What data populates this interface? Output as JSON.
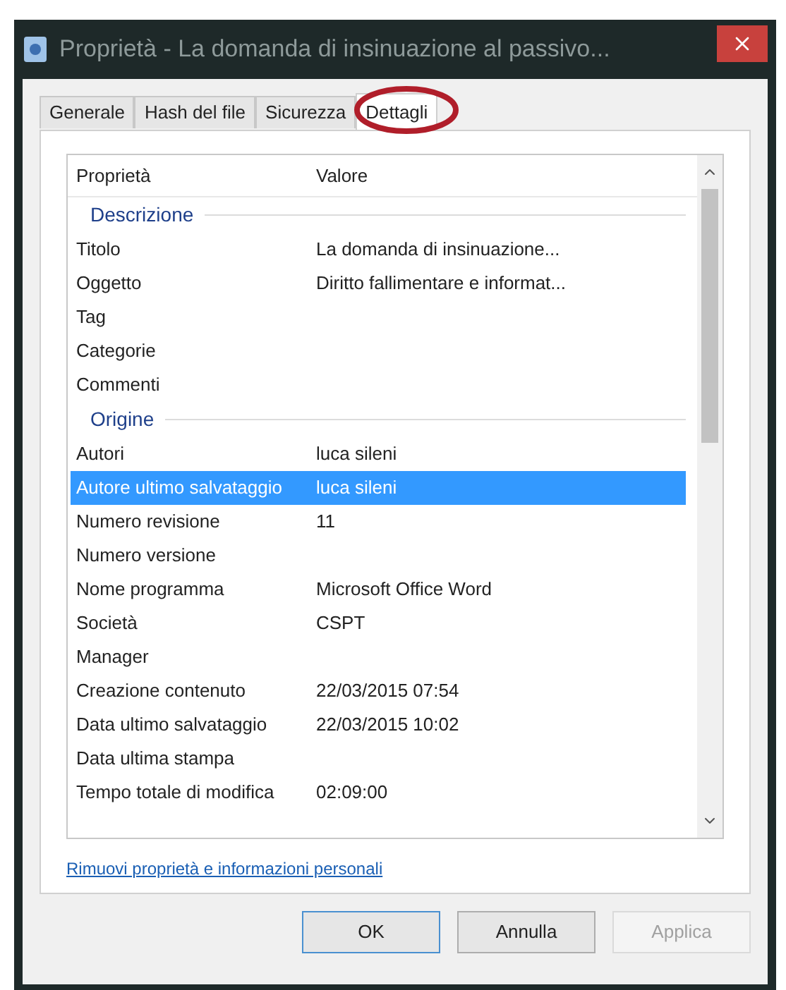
{
  "window": {
    "title": "Proprietà - La domanda di insinuazione al passivo..."
  },
  "tabs": [
    {
      "label": "Generale",
      "selected": false,
      "circled": false
    },
    {
      "label": "Hash del file",
      "selected": false,
      "circled": false
    },
    {
      "label": "Sicurezza",
      "selected": false,
      "circled": false
    },
    {
      "label": "Dettagli",
      "selected": true,
      "circled": true
    }
  ],
  "table": {
    "columns": [
      "Proprietà",
      "Valore"
    ],
    "rows": [
      {
        "kind": "group",
        "label": "Descrizione"
      },
      {
        "kind": "property",
        "name": "Titolo",
        "value": "La domanda di insinuazione...",
        "selected": false
      },
      {
        "kind": "property",
        "name": "Oggetto",
        "value": "Diritto fallimentare e informat...",
        "selected": false
      },
      {
        "kind": "property",
        "name": "Tag",
        "selected": false
      },
      {
        "kind": "property",
        "name": "Categorie",
        "selected": false
      },
      {
        "kind": "property",
        "name": "Commenti",
        "selected": false
      },
      {
        "kind": "group",
        "label": "Origine"
      },
      {
        "kind": "property",
        "name": "Autori",
        "value": "luca sileni",
        "selected": false
      },
      {
        "kind": "property",
        "name": "Autore ultimo salvataggio",
        "value": "luca sileni",
        "selected": true
      },
      {
        "kind": "property",
        "name": "Numero revisione",
        "value": "11",
        "selected": false
      },
      {
        "kind": "property",
        "name": "Numero versione",
        "selected": false
      },
      {
        "kind": "property",
        "name": "Nome programma",
        "value": "Microsoft Office Word",
        "selected": false
      },
      {
        "kind": "property",
        "name": "Società",
        "value": "CSPT",
        "selected": false
      },
      {
        "kind": "property",
        "name": "Manager",
        "selected": false
      },
      {
        "kind": "property",
        "name": "Creazione contenuto",
        "value": "22/03/2015 07:54",
        "selected": false
      },
      {
        "kind": "property",
        "name": "Data ultimo salvataggio",
        "value": "22/03/2015 10:02",
        "selected": false
      },
      {
        "kind": "property",
        "name": "Data ultima stampa",
        "selected": false
      },
      {
        "kind": "property",
        "name": "Tempo totale di modifica",
        "value": "02:09:00",
        "selected": false
      }
    ]
  },
  "link": "Rimuovi proprietà e informazioni personali",
  "buttons": [
    {
      "label": "OK",
      "disabled": false,
      "default": true
    },
    {
      "label": "Annulla",
      "disabled": false,
      "default": false
    },
    {
      "label": "Applica",
      "disabled": true,
      "default": false
    }
  ]
}
